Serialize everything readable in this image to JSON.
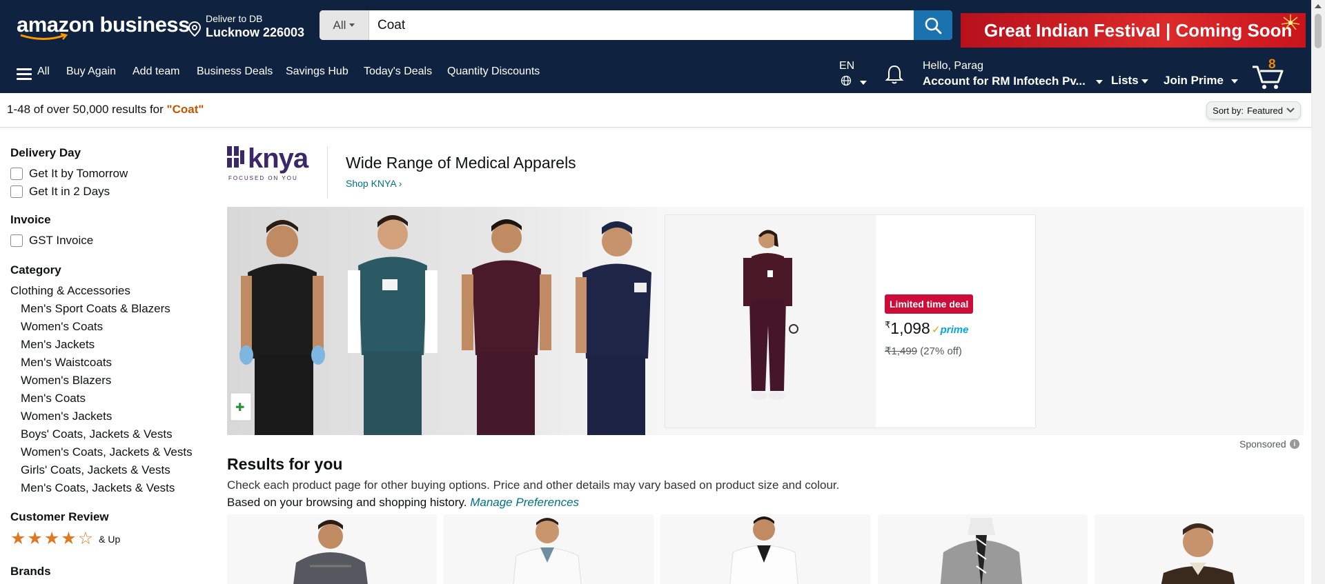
{
  "header": {
    "logo_text": "amazon business",
    "deliver_line1": "Deliver to DB",
    "deliver_line2": "Lucknow 226003",
    "search_category": "All",
    "search_value": "Coat",
    "banner_text": "Great Indian Festival | Coming Soon",
    "language": "EN",
    "greeting": "Hello, Parag",
    "account_label": "Account for RM Infotech Pv...",
    "lists_label": "Lists",
    "prime_label": "Join Prime",
    "cart_count": "8"
  },
  "nav": {
    "all": "All",
    "items": [
      "Buy Again",
      "Add team",
      "Business Deals",
      "Savings Hub",
      "Today's Deals",
      "Quantity Discounts"
    ]
  },
  "results": {
    "summary": "1-48 of over 50,000 results for ",
    "query": "\"Coat\"",
    "sort_label": "Sort by:",
    "sort_value": "Featured"
  },
  "sidebar": {
    "delivery_heading": "Delivery Day",
    "delivery_options": [
      "Get It by Tomorrow",
      "Get It in 2 Days"
    ],
    "invoice_heading": "Invoice",
    "invoice_options": [
      "GST Invoice"
    ],
    "category_heading": "Category",
    "category_root": "Clothing & Accessories",
    "categories": [
      "Men's Sport Coats & Blazers",
      "Women's Coats",
      "Men's Jackets",
      "Men's Waistcoats",
      "Women's Blazers",
      "Men's Coats",
      "Women's Jackets",
      "Boys' Coats, Jackets & Vests",
      "Women's Coats, Jackets & Vests",
      "Girls' Coats, Jackets & Vests",
      "Men's Coats, Jackets & Vests"
    ],
    "review_heading": "Customer Review",
    "review_rating": 4,
    "review_suffix": "& Up",
    "brands_heading": "Brands"
  },
  "sponsored_brand": {
    "logo_text": "knya",
    "logo_tagline": "FOCUSED ON YOU",
    "headline": "Wide Range of Medical Apparels",
    "link": "Shop KNYA ›",
    "deal_badge": "Limited time deal",
    "currency": "₹",
    "price": "1,098",
    "prime_label": "prime",
    "was_price": "₹1,499",
    "discount": "(27% off)",
    "sponsored_label": "Sponsored"
  },
  "results_section": {
    "heading": "Results for you",
    "subtext": "Check each product page for other buying options. Price and other details may vary based on product size and colour.",
    "history_text": "Based on your browsing and shopping history.",
    "manage_link": "Manage Preferences"
  },
  "colors": {
    "nav_bg": "#0f2341",
    "search_button": "#1a73ae",
    "query_highlight": "#c45500",
    "link": "#007185",
    "deal_red": "#cc0c39",
    "star": "#de7921",
    "cart_count": "#f08804"
  }
}
